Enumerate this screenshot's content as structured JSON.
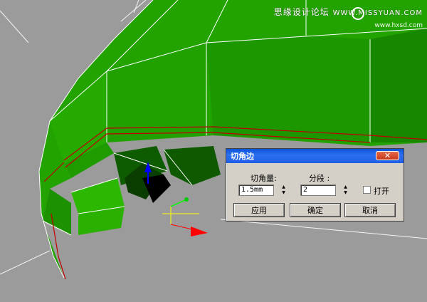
{
  "watermark": {
    "line1": "思缘设计论坛",
    "line1b": "WWW.MISSYUAN.COM",
    "line2": "www.hxsd.com"
  },
  "dialog": {
    "title": "切角边",
    "close_label": "✕",
    "chamfer_amount_label": "切角量:",
    "chamfer_amount_value": "1.5mm",
    "segments_label": "分段 :",
    "segments_value": "2",
    "open_label": "打开",
    "open_checked": false,
    "apply_label": "应用",
    "ok_label": "确定",
    "cancel_label": "取消"
  },
  "colors": {
    "viewport_bg": "#9b9b9b",
    "mesh_green": "#1e9e00",
    "selected_edge": "#c00000",
    "titlebar": "#0a55d8"
  }
}
